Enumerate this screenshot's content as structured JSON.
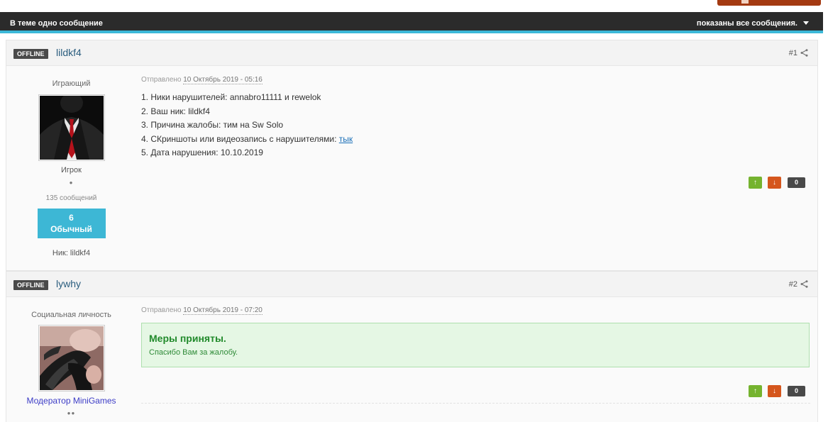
{
  "topbar": {
    "left_text": "В теме одно сообщение",
    "right_text": "показаны все сообщения."
  },
  "posts": [
    {
      "status": "OFFLINE",
      "username": "lildkf4",
      "number": "#1",
      "group": "Играющий",
      "rank": "Игрок",
      "pips": "●",
      "post_count": "135 сообщений",
      "reputation": {
        "value": "6",
        "label": "Обычный"
      },
      "nick": "Ник: lildkf4",
      "meta_prefix": "Отправлено",
      "date": "10 Октябрь 2019 - 05:16",
      "lines": [
        "1. Ники нарушителей: annabro11111 и rewelok",
        "2. Ваш ник: lildkf4",
        "3. Причина жалобы: тим на Sw Solo"
      ],
      "line4_text": "4. СКриншоты или видеозапись с нарушителями:",
      "line4_link": "тык",
      "line5": "5. Дата нарушения: 10.10.2019",
      "vote_count": "0"
    },
    {
      "status": "OFFLINE",
      "username": "lywhy",
      "number": "#2",
      "group": "Социальная личность",
      "rank": "Модератор MiniGames",
      "pips": "●●",
      "meta_prefix": "Отправлено",
      "date": "10 Октябрь 2019 - 07:20",
      "notice_title": "Меры приняты.",
      "notice_text": "Спасибо Вам за жалобу.",
      "vote_count": "0"
    }
  ],
  "icons": {
    "share": "share-icon",
    "vote_up": "arrow-up-icon",
    "vote_down": "arrow-down-icon",
    "dropdown": "caret-down-icon"
  },
  "colors": {
    "topbar_bg": "#2b2b2b",
    "accent": "#3cb8d8",
    "vote_up": "#75b32f",
    "vote_down": "#d5561d",
    "notice_bg": "#e5f7e4"
  }
}
